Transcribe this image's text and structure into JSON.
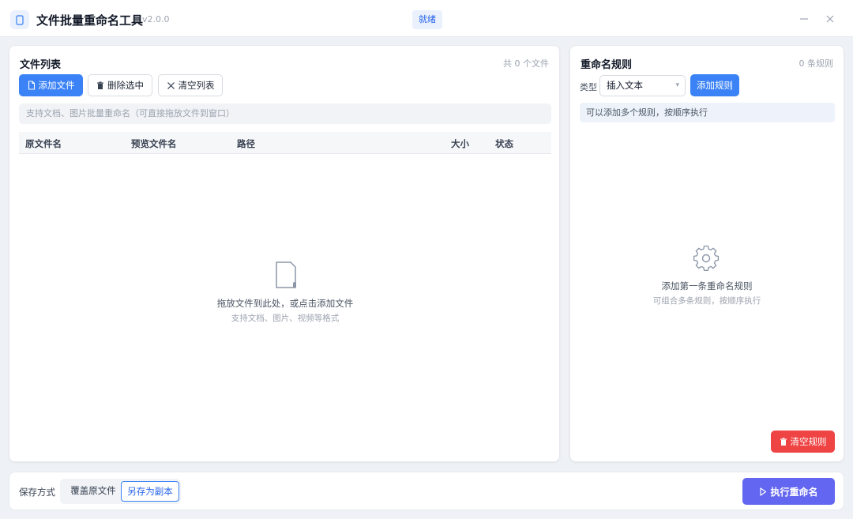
{
  "window": {
    "title": "文件批量重命名工具",
    "version": "v2.0.0",
    "status": "就绪"
  },
  "file_list": {
    "title": "文件列表",
    "count": "共 0 个文件",
    "toolbar": {
      "add_label": "添加文件",
      "delete_label": "删除选中",
      "clear_label": "清空列表"
    },
    "hint": "支持文档、图片批量重命名（可直接拖放文件到窗口）",
    "columns": [
      "原文件名",
      "预览文件名",
      "路径",
      "大小",
      "状态"
    ],
    "empty": {
      "title": "拖放文件到此处，或点击添加文件",
      "subtitle": "支持文档、图片、视频等格式"
    }
  },
  "rules": {
    "title": "重命名规则",
    "count": "0 条规则",
    "type_label": "类型",
    "type_selected": "插入文本",
    "add_label": "添加规则",
    "info": "可以添加多个规则，按顺序执行",
    "empty": {
      "title": "添加第一条重命名规则",
      "subtitle": "可组合多条规则，按顺序执行"
    },
    "clear_label": "清空规则"
  },
  "footer": {
    "save_mode_label": "保存方式",
    "options": [
      "覆盖原文件",
      "另存为副本"
    ],
    "selected_option": "另存为副本",
    "execute_label": "执行重命名"
  },
  "colors": {
    "primary": "#3b82f6",
    "danger": "#ef4444",
    "execute": "#6366f1"
  }
}
